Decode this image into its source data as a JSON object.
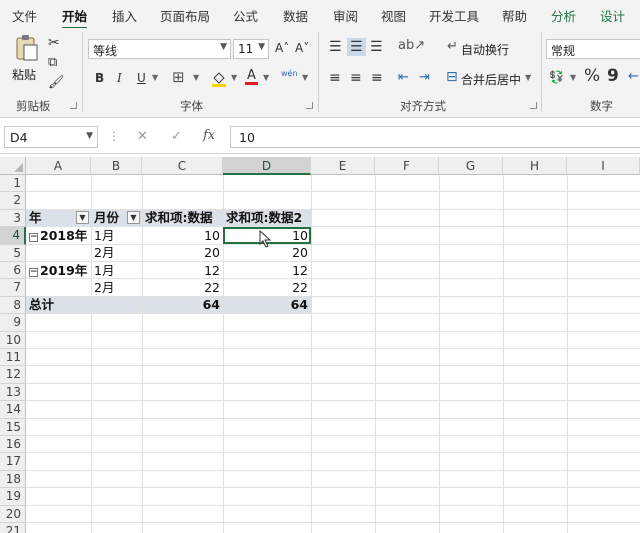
{
  "tabs": [
    "文件",
    "开始",
    "插入",
    "页面布局",
    "公式",
    "数据",
    "审阅",
    "视图",
    "开发工具",
    "帮助",
    "分析",
    "设计"
  ],
  "active_tab": "开始",
  "ribbon": {
    "clipboard": {
      "label": "剪贴板",
      "paste": "粘贴"
    },
    "font": {
      "label": "字体",
      "name": "等线",
      "size": "11",
      "bold": "B",
      "italic": "I",
      "underline": "U",
      "grow": "A˄",
      "shrink": "A˅",
      "font_color": "A",
      "phonetic": "wén"
    },
    "alignment": {
      "label": "对齐方式",
      "wrap": "自动换行",
      "merge": "合并后居中"
    },
    "number": {
      "label": "数字",
      "format": "常规",
      "percent": "%",
      "comma": "9"
    }
  },
  "formula_bar": {
    "name_box": "D4",
    "fx": "fx",
    "cancel": "✕",
    "confirm": "✓",
    "value": "10"
  },
  "columns": [
    "A",
    "B",
    "C",
    "D",
    "E",
    "F",
    "G",
    "H",
    "I"
  ],
  "rows": [
    "1",
    "2",
    "3",
    "4",
    "5",
    "6",
    "7",
    "8",
    "9",
    "10",
    "11",
    "12",
    "13",
    "14",
    "15",
    "16",
    "17",
    "18",
    "19",
    "20",
    "21"
  ],
  "selected_cell": "D4",
  "pivot": {
    "header": {
      "a": "年",
      "b": "月份",
      "c": "求和项:数据",
      "d": "求和项:数据2"
    },
    "rows": [
      {
        "a": "2018年",
        "b": "1月",
        "c": "10",
        "d": "10"
      },
      {
        "a": "",
        "b": "2月",
        "c": "20",
        "d": "20"
      },
      {
        "a": "2019年",
        "b": "1月",
        "c": "12",
        "d": "12"
      },
      {
        "a": "",
        "b": "2月",
        "c": "22",
        "d": "22"
      }
    ],
    "total": {
      "a": "总计",
      "c": "64",
      "d": "64"
    }
  }
}
